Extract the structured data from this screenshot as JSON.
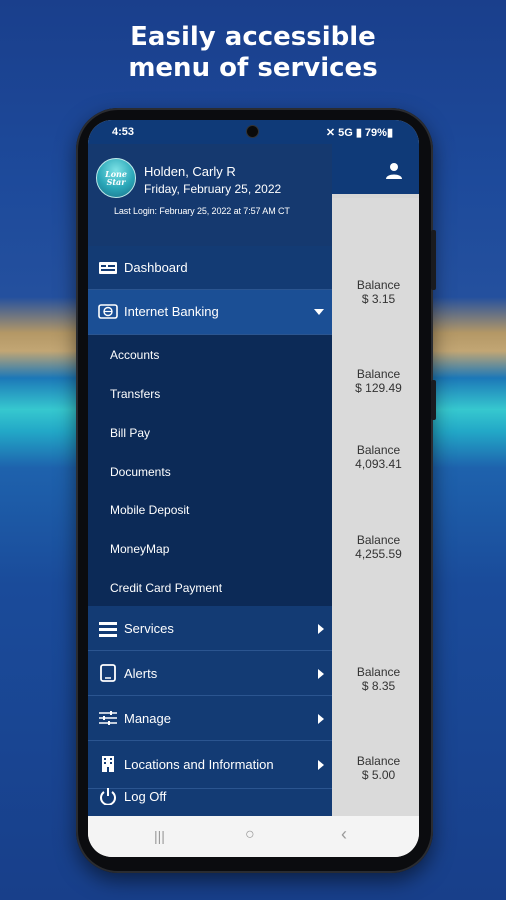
{
  "promo": {
    "line1": "Easily accessible",
    "line2": "menu of services"
  },
  "status": {
    "time": "4:53",
    "right": "✕ 5G ▮ 79%▮"
  },
  "user": {
    "name": "Holden, Carly R",
    "date": "Friday, February 25, 2022",
    "last_login": "Last Login: February 25, 2022 at 7:57 AM CT",
    "logo_text": "Lone Star"
  },
  "menu": {
    "dashboard": "Dashboard",
    "internet_banking": "Internet Banking",
    "sub_items": [
      "Accounts",
      "Transfers",
      "Bill Pay",
      "Documents",
      "Mobile Deposit",
      "MoneyMap",
      "Credit Card Payment"
    ],
    "services": "Services",
    "alerts": "Alerts",
    "manage": "Manage",
    "locations": "Locations and Information",
    "logoff": "Log Off"
  },
  "balances": [
    {
      "label": "Balance",
      "amount": "$ 3.15"
    },
    {
      "label": "Balance",
      "amount": "$ 129.49"
    },
    {
      "label": "Balance",
      "amount": "4,093.41"
    },
    {
      "label": "Balance",
      "amount": "4,255.59"
    },
    {
      "label": "Balance",
      "amount": "$ 8.35"
    },
    {
      "label": "Balance",
      "amount": "$ 5.00"
    }
  ],
  "navbar": {
    "recents": "|||",
    "home": "○",
    "back": "‹"
  },
  "colors": {
    "drawer": "#133b74",
    "submenu": "#0c2a57",
    "active": "#1b4f95"
  }
}
